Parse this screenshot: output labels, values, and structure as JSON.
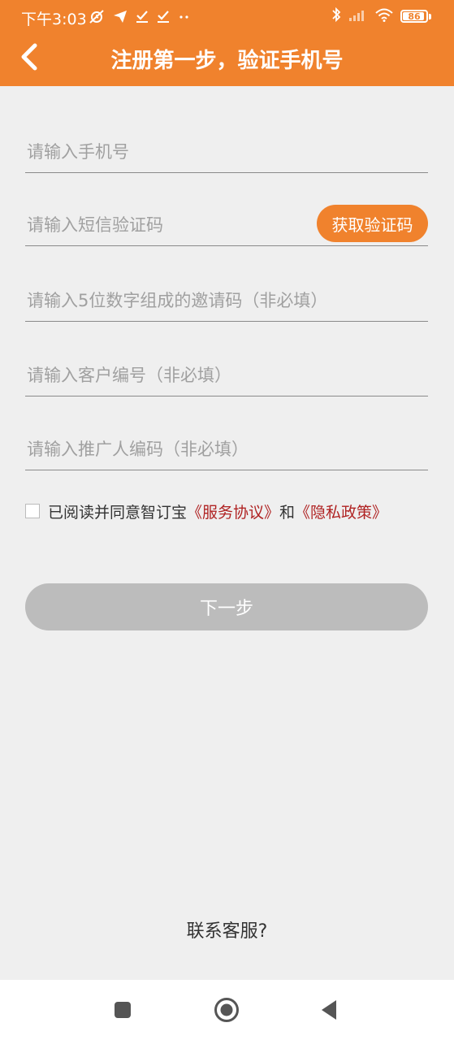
{
  "status_bar": {
    "time": "下午3:03",
    "battery_level": "86"
  },
  "header": {
    "title": "注册第一步，验证手机号"
  },
  "form": {
    "phone_placeholder": "请输入手机号",
    "sms_code_placeholder": "请输入短信验证码",
    "get_code_label": "获取验证码",
    "invite_code_placeholder": "请输入5位数字组成的邀请码（非必填）",
    "customer_id_placeholder": "请输入客户编号（非必填）",
    "promoter_code_placeholder": "请输入推广人编码（非必填）"
  },
  "agreement": {
    "prefix": "已阅读并同意智订宝",
    "service_link": "《服务协议》",
    "conjunction": "和",
    "privacy_link": "《隐私政策》"
  },
  "next_label": "下一步",
  "support_label": "联系客服?",
  "colors": {
    "accent": "#f0822d",
    "link": "#b02323",
    "disabled_button": "#bcbcbc",
    "background": "#efefef"
  }
}
